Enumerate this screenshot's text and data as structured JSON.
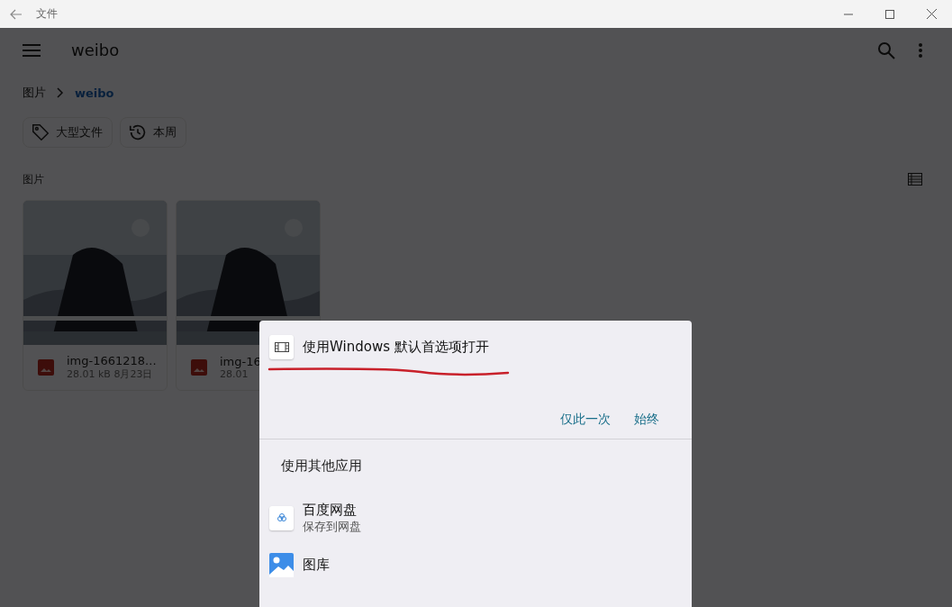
{
  "window": {
    "title": "文件"
  },
  "app_bar": {
    "title": "weibo"
  },
  "breadcrumb": [
    {
      "label": "图片",
      "selected": false
    },
    {
      "label": "weibo",
      "selected": true
    }
  ],
  "chips": [
    {
      "label": "大型文件",
      "kind": "tag"
    },
    {
      "label": "本周",
      "kind": "history"
    }
  ],
  "section": {
    "label": "图片"
  },
  "files": [
    {
      "name": "img-1661218...",
      "meta": "28.01 kB 8月23日"
    },
    {
      "name": "img-16",
      "meta": "28.01"
    }
  ],
  "sheet": {
    "default_app": {
      "label": "使用Windows 默认首选项打开"
    },
    "buttons": [
      "仅此一次",
      "始终"
    ],
    "other_heading": "使用其他应用",
    "apps": [
      {
        "kind": "baidu",
        "name": "百度网盘",
        "subtitle": "保存到网盘"
      },
      {
        "kind": "gallery",
        "name": "图库"
      }
    ]
  }
}
